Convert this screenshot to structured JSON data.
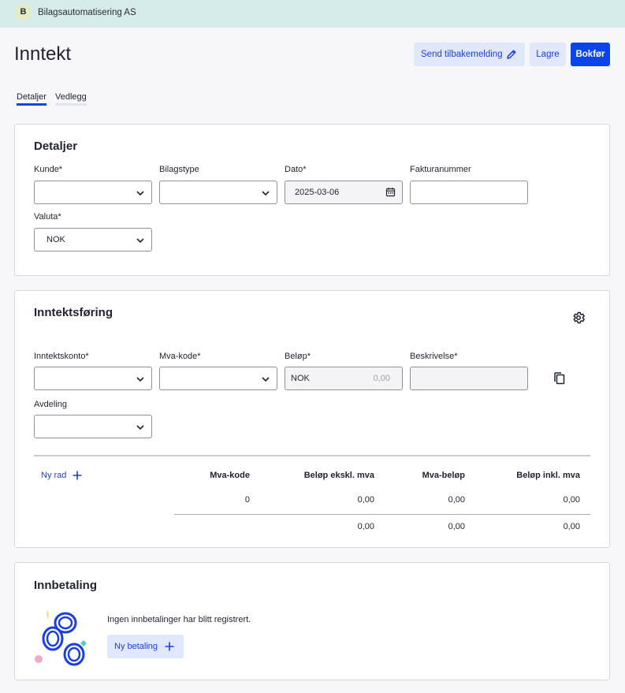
{
  "company": {
    "initial": "B",
    "name": "Bilagsautomatisering AS"
  },
  "page": {
    "title": "Inntekt"
  },
  "actions": {
    "send_feedback": "Send tilbakemelding",
    "save": "Lagre",
    "post": "Bokfør"
  },
  "tabs": [
    {
      "label": "Detaljer",
      "active": true
    },
    {
      "label": "Vedlegg",
      "active": false
    }
  ],
  "details": {
    "title": "Detaljer",
    "customer_label": "Kunde*",
    "voucher_type_label": "Bilagstype",
    "date_label": "Dato*",
    "date_value": "2025-03-06",
    "invoice_number_label": "Fakturanummer",
    "currency_label": "Valuta*",
    "currency_value": "NOK"
  },
  "income": {
    "title": "Inntektsføring",
    "account_label": "Inntektskonto*",
    "vat_code_label": "Mva-kode*",
    "amount_label": "Beløp*",
    "amount_currency": "NOK",
    "amount_placeholder": "0,00",
    "description_label": "Beskrivelse*",
    "department_label": "Avdeling",
    "new_row": "Ny rad",
    "summary": {
      "headers": [
        "Mva-kode",
        "Beløp ekskl. mva",
        "Mva-beløp",
        "Beløp inkl. mva"
      ],
      "row": [
        "0",
        "0,00",
        "0,00",
        "0,00"
      ],
      "totals": [
        "0,00",
        "0,00",
        "0,00"
      ]
    }
  },
  "payment": {
    "title": "Innbetaling",
    "empty_message": "Ingen innbetalinger har blitt registrert.",
    "new_payment": "Ny betaling"
  },
  "colors": {
    "primary": "#0a45ec",
    "primary_light": "#e1e8fb",
    "topbar": "#d6ecea"
  }
}
